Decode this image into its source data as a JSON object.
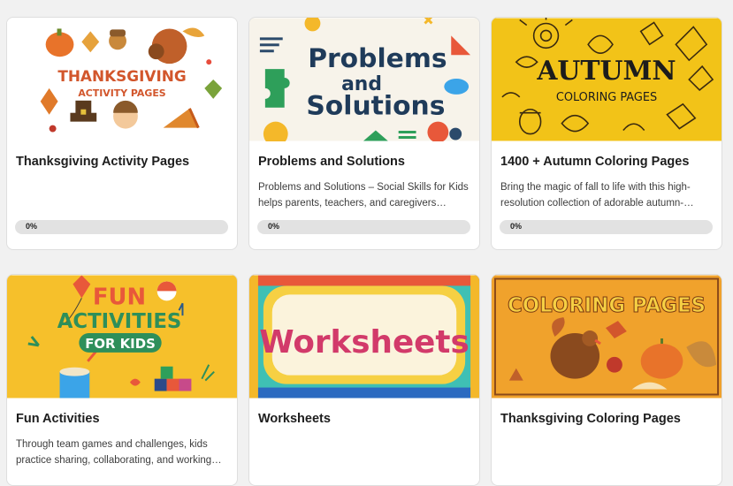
{
  "cards": [
    {
      "title": "Thanksgiving Activity Pages",
      "description": "",
      "progress_label": "0%",
      "progress": 0,
      "thumb": {
        "line1": "THANKSGIVING",
        "line2": "ACTIVITY PAGES",
        "bg": "#ffffff"
      }
    },
    {
      "title": "Problems and Solutions",
      "description": "Problems and Solutions – Social Skills for Kids helps parents, teachers, and caregivers…",
      "progress_label": "0%",
      "progress": 0,
      "thumb": {
        "line1": "Problems",
        "line2": "and",
        "line3": "Solutions",
        "bg": "#f7f3ea"
      }
    },
    {
      "title": "1400 + Autumn Coloring Pages",
      "description": "Bring the magic of fall to life with this high-resolution collection of adorable autumn-…",
      "progress_label": "0%",
      "progress": 0,
      "thumb": {
        "line1": "AUTUMN",
        "line2": "COLORING PAGES",
        "bg": "#f2c318"
      }
    },
    {
      "title": "Fun Activities",
      "description": "Through team games and challenges, kids practice sharing, collaborating, and working…",
      "thumb": {
        "line1": "FUN",
        "line2": "ACTIVITIES",
        "line3": "FOR KIDS",
        "bg": "#f6c02b"
      }
    },
    {
      "title": "Worksheets",
      "description": "",
      "thumb": {
        "line1": "Worksheets",
        "bg": "#3fc0b4"
      }
    },
    {
      "title": "Thanksgiving Coloring Pages",
      "description": "",
      "thumb": {
        "line1": "COLORING PAGES",
        "bg": "#f0a22c"
      }
    }
  ]
}
